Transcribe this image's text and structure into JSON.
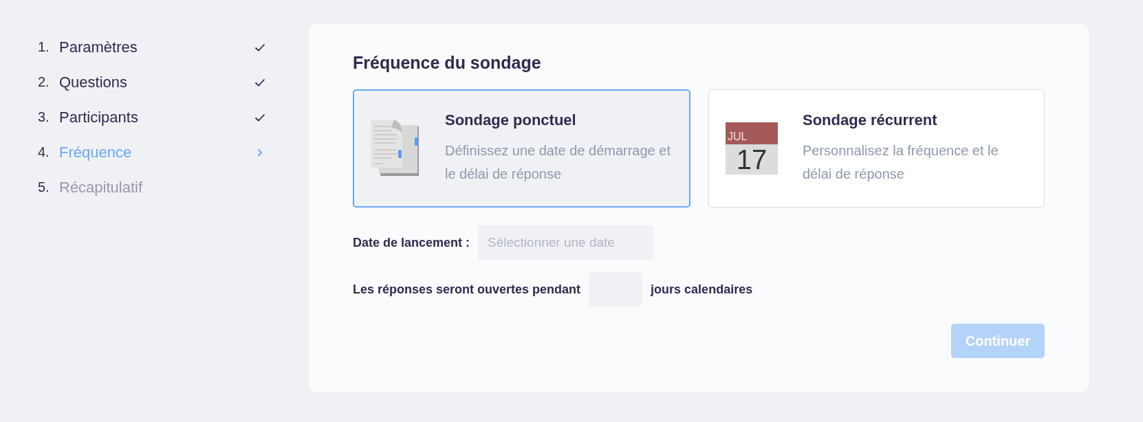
{
  "steps": [
    {
      "number": "1.",
      "label": "Paramètres",
      "completed": true,
      "selected": false
    },
    {
      "number": "2.",
      "label": "Questions",
      "completed": true,
      "selected": false
    },
    {
      "number": "3.",
      "label": "Participants",
      "completed": true,
      "selected": false
    },
    {
      "number": "4.",
      "label": "Fréquence",
      "completed": false,
      "selected": true
    },
    {
      "number": "5.",
      "label": "Récapitulatif",
      "completed": false,
      "selected": false
    }
  ],
  "title": "Fréquence du sondage",
  "options": [
    {
      "kind": "document",
      "title": "Sondage ponctuel",
      "description": "Définissez une date de démarrage et le délai de réponse",
      "selected": true
    },
    {
      "kind": "calendar",
      "title": "Sondage récurrent",
      "description": "Personnalisez la fréquence et le délai de réponse",
      "selected": false,
      "calendar_month": "JUL",
      "calendar_day": "17"
    }
  ],
  "launch_date": {
    "label": "Date de lancement :",
    "placeholder": "Sélectionner une date"
  },
  "duration": {
    "before": "Les réponses seront ouvertes pendant",
    "after": "jours calendaires"
  },
  "continue_button": {
    "label": "Continuer",
    "disabled": true
  }
}
